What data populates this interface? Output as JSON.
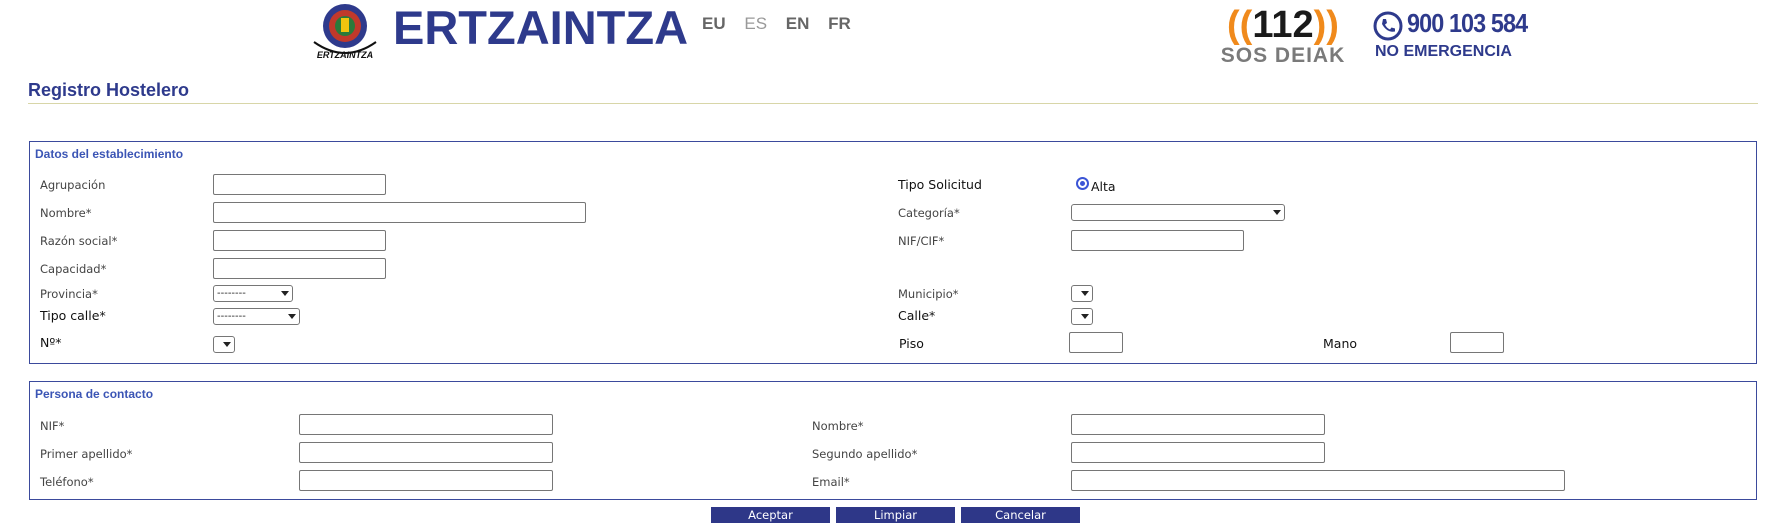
{
  "header": {
    "brand": "ERTZAINTZA",
    "emblem_text": "ERTZAINTZA",
    "languages": [
      "EU",
      "ES",
      "EN",
      "FR"
    ],
    "sos_number": "112",
    "sos_text": "SOS DEIAK",
    "phone_number": "900 103 584",
    "phone_subtitle": "NO EMERGENCIA"
  },
  "page": {
    "title": "Registro Hostelero"
  },
  "establecimiento": {
    "legend": "Datos del establecimiento",
    "agrupacion_label": "Agrupación",
    "nombre_label": "Nombre*",
    "razon_social_label": "Razón social*",
    "capacidad_label": "Capacidad*",
    "provincia_label": "Provincia*",
    "provincia_value": "--------",
    "tipo_calle_label": "Tipo calle*",
    "tipo_calle_value": "--------",
    "numero_label": "Nº*",
    "tipo_solicitud_label": "Tipo Solicitud",
    "tipo_solicitud_option": "Alta",
    "categoria_label": "Categoría*",
    "nif_cif_label": "NIF/CIF*",
    "municipio_label": "Municipio*",
    "calle_label": "Calle*",
    "piso_label": "Piso",
    "mano_label": "Mano"
  },
  "contacto": {
    "legend": "Persona de contacto",
    "nif_label": "NIF*",
    "primer_apellido_label": "Primer apellido*",
    "telefono_label": "Teléfono*",
    "nombre_label": "Nombre*",
    "segundo_apellido_label": "Segundo apellido*",
    "email_label": "Email*"
  },
  "actions": {
    "accept_label": "Aceptar",
    "clear_label": "Limpiar",
    "cancel_label": "Cancelar"
  },
  "colors": {
    "brand_blue": "#2e3a8c",
    "legend_blue": "#3b55b5",
    "button_bg": "#2e3788",
    "sos_orange": "#f08a1c"
  }
}
